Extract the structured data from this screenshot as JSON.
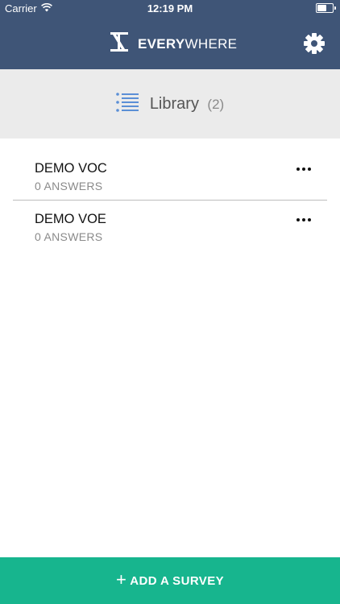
{
  "status_bar": {
    "carrier": "Carrier",
    "time": "12:19 PM",
    "battery_level": 0.6
  },
  "header": {
    "brand_bold": "EVERY",
    "brand_light": "WHERE",
    "logo_icon": "everywhere-logo-icon",
    "settings_icon": "gear-icon"
  },
  "library": {
    "title": "Library",
    "count": "(2)",
    "icon": "list-icon"
  },
  "surveys": [
    {
      "name": "DEMO VOC",
      "answers": "0 ANSWERS"
    },
    {
      "name": "DEMO VOE",
      "answers": "0 ANSWERS"
    }
  ],
  "footer": {
    "add_label": "ADD A SURVEY"
  },
  "colors": {
    "header_bg": "#3f5577",
    "library_bg": "#ebebeb",
    "accent": "#17b58e",
    "list_icon": "#5b8fd6"
  }
}
